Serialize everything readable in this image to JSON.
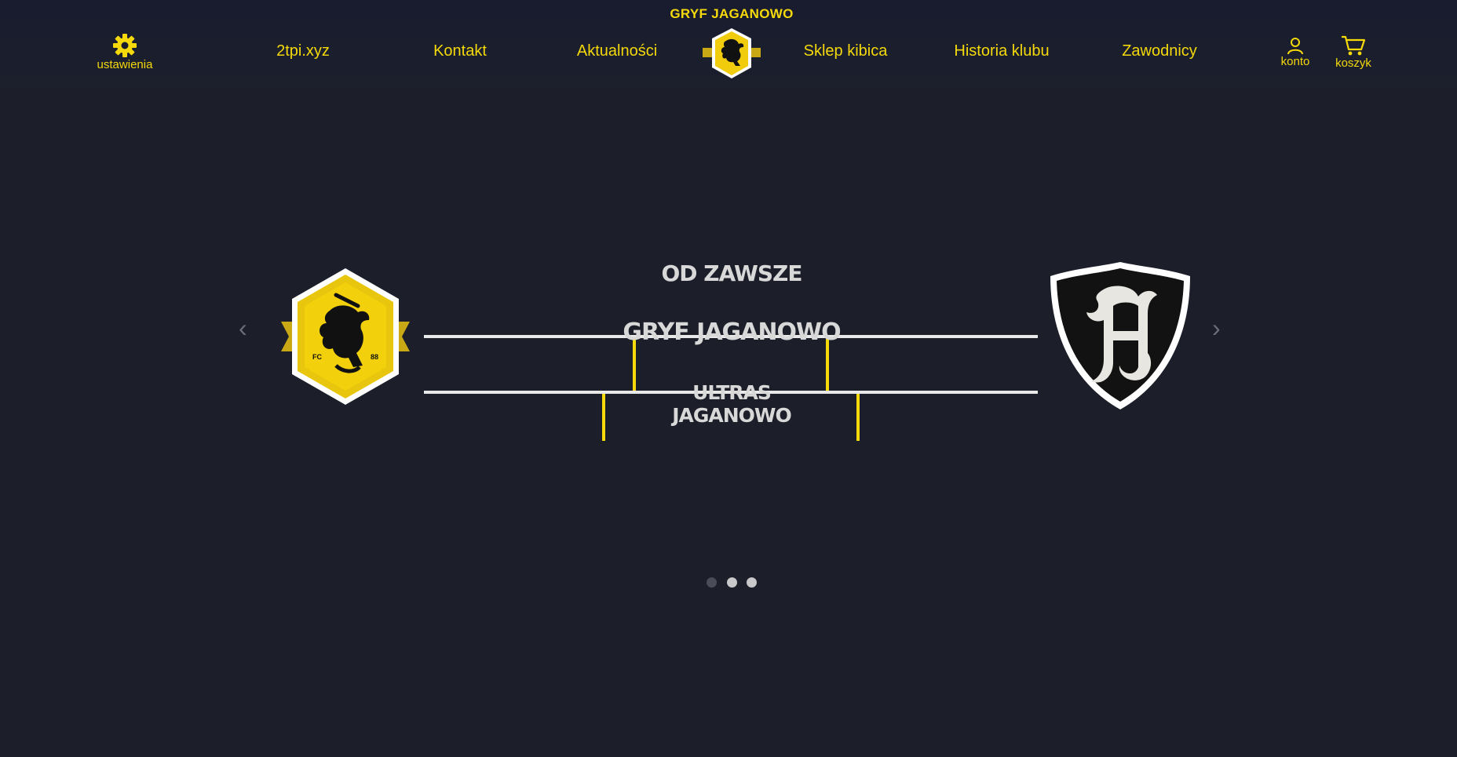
{
  "header": {
    "site_title": "GRYF JAGANOWO",
    "settings_label": "ustawienia",
    "nav": {
      "item1": "2tpi.xyz",
      "item2": "Kontakt",
      "item3": "Aktualności",
      "item4": "Sklep kibica",
      "item5": "Historia klubu",
      "item6": "Zawodnicy"
    },
    "account_label": "konto",
    "cart_label": "koszyk"
  },
  "slider": {
    "banner": {
      "line1": "OD ZAWSZE",
      "line2": "GRYF JAGANOWO",
      "line3": "ULTRAS JAGANOWO"
    },
    "left_crest_text_left": "FC",
    "left_crest_text_right": "88",
    "prev_arrow": "‹",
    "next_arrow": "›",
    "dots_total": 3,
    "dots_active_index": 0
  },
  "colors": {
    "accent": "#f5d90a",
    "background": "#1c1f29",
    "banner_text": "#d8d8d8",
    "banner_lines": "#e8e8e8"
  },
  "icons": {
    "settings": "gear-icon",
    "account": "user-icon",
    "cart": "cart-icon"
  }
}
